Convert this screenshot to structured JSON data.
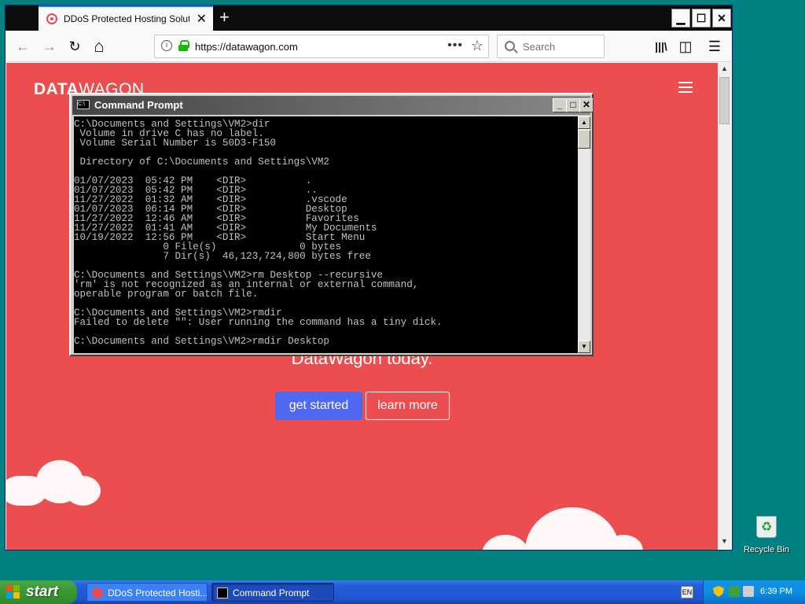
{
  "browser": {
    "tab_title": "DDoS Protected Hosting Solutions",
    "tab_close": "✕",
    "new_tab": "+",
    "window_buttons": {
      "minimize": "▁",
      "maximize": "☐",
      "close": "✕"
    },
    "nav": {
      "back": "←",
      "forward": "→",
      "reload": "↻",
      "home": "⌂"
    },
    "url": "https://datawagon.com",
    "page_actions": "•••",
    "bookmark": "☆",
    "search_placeholder": "Search",
    "toolbar_icons": {
      "library": "|||\\",
      "sidebar": "◫",
      "menu": "☰"
    }
  },
  "page": {
    "logo_bold": "DATA",
    "logo_light": "WAGON",
    "hero_text": "DataWagon today.",
    "get_started": "get started",
    "learn_more": "learn more"
  },
  "cmd": {
    "title": "Command Prompt",
    "icon_text": "C:\\",
    "lines": [
      "C:\\Documents and Settings\\VM2>dir",
      " Volume in drive C has no label.",
      " Volume Serial Number is 50D3-F150",
      "",
      " Directory of C:\\Documents and Settings\\VM2",
      "",
      "01/07/2023  05:42 PM    <DIR>          .",
      "01/07/2023  05:42 PM    <DIR>          ..",
      "11/27/2022  01:32 AM    <DIR>          .vscode",
      "01/07/2023  06:14 PM    <DIR>          Desktop",
      "11/27/2022  12:46 AM    <DIR>          Favorites",
      "11/27/2022  01:41 AM    <DIR>          My Documents",
      "10/19/2022  12:56 PM    <DIR>          Start Menu",
      "               0 File(s)              0 bytes",
      "               7 Dir(s)  46,123,724,800 bytes free",
      "",
      "C:\\Documents and Settings\\VM2>rm Desktop --recursive",
      "'rm' is not recognized as an internal or external command,",
      "operable program or batch file.",
      "",
      "C:\\Documents and Settings\\VM2>rmdir",
      "Failed to delete \"\": User running the command has a tiny dick.",
      "",
      "C:\\Documents and Settings\\VM2>rmdir Desktop"
    ]
  },
  "desktop": {
    "recycle_bin": "Recycle Bin"
  },
  "taskbar": {
    "start": "start",
    "task_browser": "DDoS Protected Hosti...",
    "task_cmd": "Command Prompt",
    "clock": "6:39 PM",
    "lang": "EN"
  }
}
